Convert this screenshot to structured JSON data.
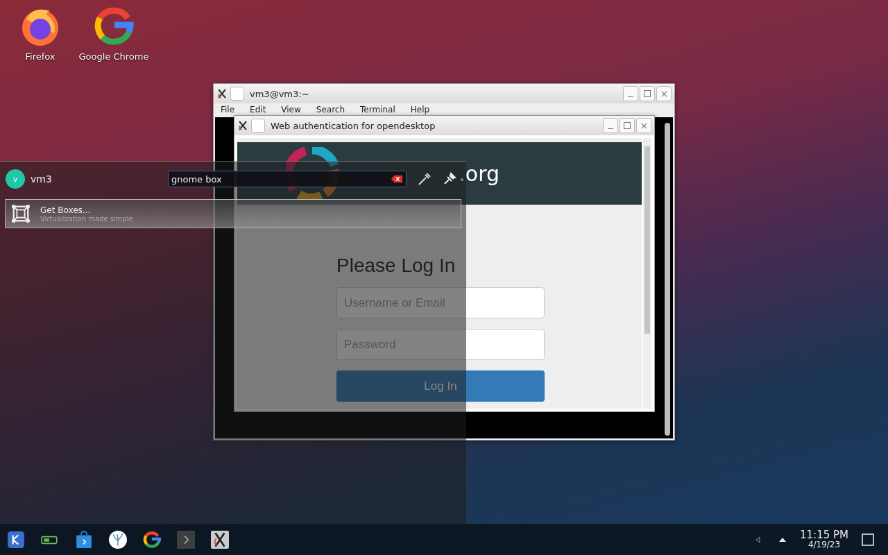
{
  "desktop_icons": [
    {
      "label": "Firefox",
      "kind": "firefox"
    },
    {
      "label": "Google Chrome",
      "kind": "chrome"
    }
  ],
  "terminal_window": {
    "title": "vm3@vm3:~",
    "menu": [
      "File",
      "Edit",
      "View",
      "Search",
      "Terminal",
      "Help"
    ]
  },
  "auth_window": {
    "title": "Web authentication for opendesktop",
    "banner_text": ".org",
    "heading": "Please Log In",
    "username": {
      "placeholder": "Username or Email"
    },
    "password": {
      "placeholder": "Password"
    },
    "button": "Log In"
  },
  "launcher": {
    "avatar_letter": "v",
    "user": "vm3",
    "search": {
      "value": "gnome box"
    },
    "results": [
      {
        "title": "Get Boxes...",
        "subtitle": "Virtualization made simple",
        "selected": true
      }
    ]
  },
  "taskbar": {
    "clock": {
      "time": "11:15 PM",
      "date": "4/19/23"
    }
  }
}
